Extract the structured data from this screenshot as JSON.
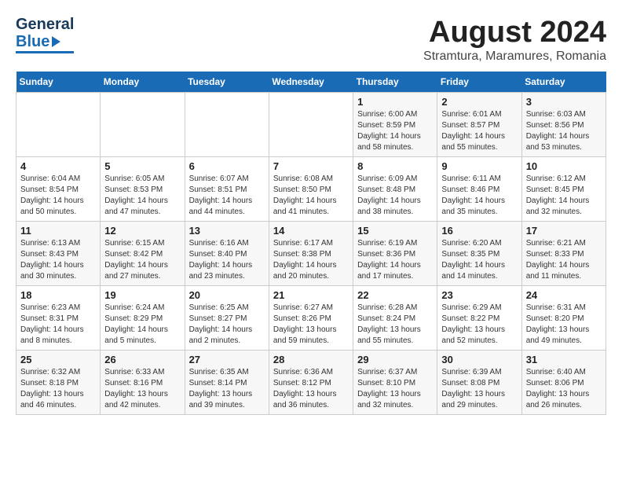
{
  "header": {
    "logo_top": "General",
    "logo_bottom": "Blue",
    "main_title": "August 2024",
    "subtitle": "Stramtura, Maramures, Romania"
  },
  "weekdays": [
    "Sunday",
    "Monday",
    "Tuesday",
    "Wednesday",
    "Thursday",
    "Friday",
    "Saturday"
  ],
  "weeks": [
    [
      {
        "day": "",
        "info": ""
      },
      {
        "day": "",
        "info": ""
      },
      {
        "day": "",
        "info": ""
      },
      {
        "day": "",
        "info": ""
      },
      {
        "day": "1",
        "sunrise": "6:00 AM",
        "sunset": "8:59 PM",
        "daylight": "14 hours and 58 minutes."
      },
      {
        "day": "2",
        "sunrise": "6:01 AM",
        "sunset": "8:57 PM",
        "daylight": "14 hours and 55 minutes."
      },
      {
        "day": "3",
        "sunrise": "6:03 AM",
        "sunset": "8:56 PM",
        "daylight": "14 hours and 53 minutes."
      }
    ],
    [
      {
        "day": "4",
        "sunrise": "6:04 AM",
        "sunset": "8:54 PM",
        "daylight": "14 hours and 50 minutes."
      },
      {
        "day": "5",
        "sunrise": "6:05 AM",
        "sunset": "8:53 PM",
        "daylight": "14 hours and 47 minutes."
      },
      {
        "day": "6",
        "sunrise": "6:07 AM",
        "sunset": "8:51 PM",
        "daylight": "14 hours and 44 minutes."
      },
      {
        "day": "7",
        "sunrise": "6:08 AM",
        "sunset": "8:50 PM",
        "daylight": "14 hours and 41 minutes."
      },
      {
        "day": "8",
        "sunrise": "6:09 AM",
        "sunset": "8:48 PM",
        "daylight": "14 hours and 38 minutes."
      },
      {
        "day": "9",
        "sunrise": "6:11 AM",
        "sunset": "8:46 PM",
        "daylight": "14 hours and 35 minutes."
      },
      {
        "day": "10",
        "sunrise": "6:12 AM",
        "sunset": "8:45 PM",
        "daylight": "14 hours and 32 minutes."
      }
    ],
    [
      {
        "day": "11",
        "sunrise": "6:13 AM",
        "sunset": "8:43 PM",
        "daylight": "14 hours and 30 minutes."
      },
      {
        "day": "12",
        "sunrise": "6:15 AM",
        "sunset": "8:42 PM",
        "daylight": "14 hours and 27 minutes."
      },
      {
        "day": "13",
        "sunrise": "6:16 AM",
        "sunset": "8:40 PM",
        "daylight": "14 hours and 23 minutes."
      },
      {
        "day": "14",
        "sunrise": "6:17 AM",
        "sunset": "8:38 PM",
        "daylight": "14 hours and 20 minutes."
      },
      {
        "day": "15",
        "sunrise": "6:19 AM",
        "sunset": "8:36 PM",
        "daylight": "14 hours and 17 minutes."
      },
      {
        "day": "16",
        "sunrise": "6:20 AM",
        "sunset": "8:35 PM",
        "daylight": "14 hours and 14 minutes."
      },
      {
        "day": "17",
        "sunrise": "6:21 AM",
        "sunset": "8:33 PM",
        "daylight": "14 hours and 11 minutes."
      }
    ],
    [
      {
        "day": "18",
        "sunrise": "6:23 AM",
        "sunset": "8:31 PM",
        "daylight": "14 hours and 8 minutes."
      },
      {
        "day": "19",
        "sunrise": "6:24 AM",
        "sunset": "8:29 PM",
        "daylight": "14 hours and 5 minutes."
      },
      {
        "day": "20",
        "sunrise": "6:25 AM",
        "sunset": "8:27 PM",
        "daylight": "14 hours and 2 minutes."
      },
      {
        "day": "21",
        "sunrise": "6:27 AM",
        "sunset": "8:26 PM",
        "daylight": "13 hours and 59 minutes."
      },
      {
        "day": "22",
        "sunrise": "6:28 AM",
        "sunset": "8:24 PM",
        "daylight": "13 hours and 55 minutes."
      },
      {
        "day": "23",
        "sunrise": "6:29 AM",
        "sunset": "8:22 PM",
        "daylight": "13 hours and 52 minutes."
      },
      {
        "day": "24",
        "sunrise": "6:31 AM",
        "sunset": "8:20 PM",
        "daylight": "13 hours and 49 minutes."
      }
    ],
    [
      {
        "day": "25",
        "sunrise": "6:32 AM",
        "sunset": "8:18 PM",
        "daylight": "13 hours and 46 minutes."
      },
      {
        "day": "26",
        "sunrise": "6:33 AM",
        "sunset": "8:16 PM",
        "daylight": "13 hours and 42 minutes."
      },
      {
        "day": "27",
        "sunrise": "6:35 AM",
        "sunset": "8:14 PM",
        "daylight": "13 hours and 39 minutes."
      },
      {
        "day": "28",
        "sunrise": "6:36 AM",
        "sunset": "8:12 PM",
        "daylight": "13 hours and 36 minutes."
      },
      {
        "day": "29",
        "sunrise": "6:37 AM",
        "sunset": "8:10 PM",
        "daylight": "13 hours and 32 minutes."
      },
      {
        "day": "30",
        "sunrise": "6:39 AM",
        "sunset": "8:08 PM",
        "daylight": "13 hours and 29 minutes."
      },
      {
        "day": "31",
        "sunrise": "6:40 AM",
        "sunset": "8:06 PM",
        "daylight": "13 hours and 26 minutes."
      }
    ]
  ]
}
